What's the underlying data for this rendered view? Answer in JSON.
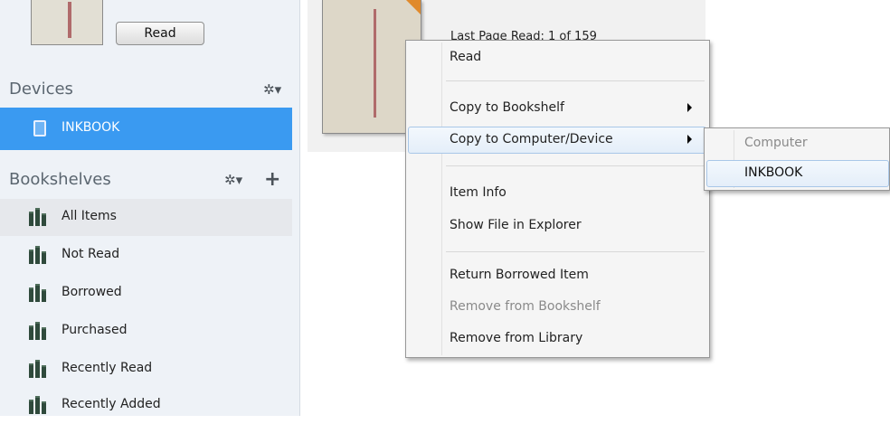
{
  "top": {
    "read_label": "Read"
  },
  "devices": {
    "title": "Devices",
    "items": [
      {
        "label": "INKBOOK"
      }
    ]
  },
  "bookshelves": {
    "title": "Bookshelves",
    "items": [
      {
        "label": "All Items"
      },
      {
        "label": "Not Read"
      },
      {
        "label": "Borrowed"
      },
      {
        "label": "Purchased"
      },
      {
        "label": "Recently Read"
      },
      {
        "label": "Recently Added"
      }
    ]
  },
  "book": {
    "last_page_read": "Last Page Read: 1 of 159"
  },
  "context_menu": {
    "items": [
      {
        "label": "Read"
      },
      {
        "label": "Copy to Bookshelf"
      },
      {
        "label": "Copy to Computer/Device"
      },
      {
        "label": "Item Info"
      },
      {
        "label": "Show File in Explorer"
      },
      {
        "label": "Return Borrowed Item"
      },
      {
        "label": "Remove from Bookshelf"
      },
      {
        "label": "Remove from Library"
      }
    ]
  },
  "submenu": {
    "items": [
      {
        "label": "Computer"
      },
      {
        "label": "INKBOOK"
      }
    ]
  },
  "colors": {
    "selection": "#3a9af1",
    "menu_hover_border": "#a9c7e8"
  }
}
